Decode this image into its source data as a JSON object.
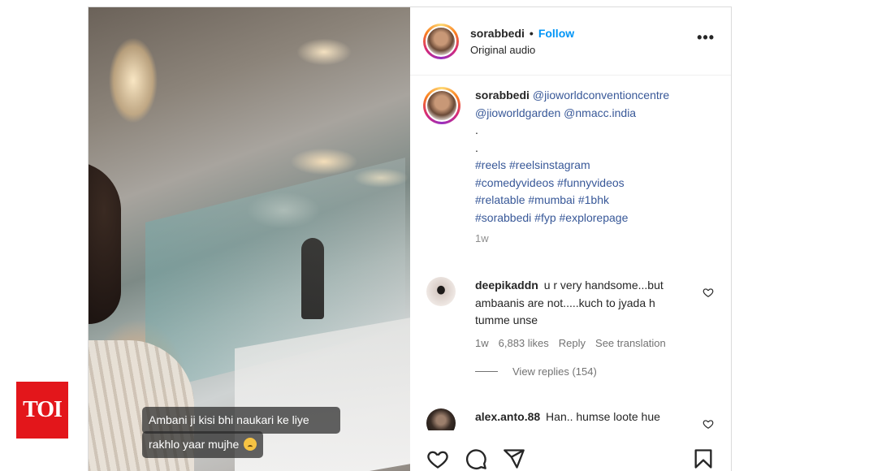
{
  "toi_logo": "TOI",
  "video": {
    "caption_line1": "Ambani ji kisi bhi naukari ke liye",
    "caption_line2": "rakhlo yaar mujhe"
  },
  "header": {
    "username": "sorabbedi",
    "separator": "•",
    "follow_label": "Follow",
    "audio_label": "Original audio",
    "more_label": "•••"
  },
  "caption": {
    "username": "sorabbedi",
    "mentions": [
      "@jioworldconventioncentre",
      "@jioworldgarden",
      "@nmacc.india"
    ],
    "dot_lines": [
      ".",
      "."
    ],
    "hashtag_lines": [
      "#reels #reelsinstagram",
      "#comedyvideos #funnyvideos",
      "#relatable #mumbai #1bhk",
      "#sorabbedi #fyp #explorepage"
    ],
    "time": "1w"
  },
  "comments": [
    {
      "username": "deepikaddn",
      "text": "u r very handsome...but ambaanis are not.....kuch to jyada h tumme unse",
      "time": "1w",
      "likes": "6,883 likes",
      "reply_label": "Reply",
      "translation_label": "See translation"
    },
    {
      "username": "alex.anto.88",
      "text": "Han.. humse loote hue paisa"
    }
  ],
  "view_replies": "View replies (154)",
  "icons": {
    "like": "heart-icon",
    "comment": "comment-icon",
    "share": "send-icon",
    "save": "bookmark-icon"
  },
  "colors": {
    "follow": "#0095f6",
    "link": "#385898",
    "toi_red": "#e3161b"
  }
}
